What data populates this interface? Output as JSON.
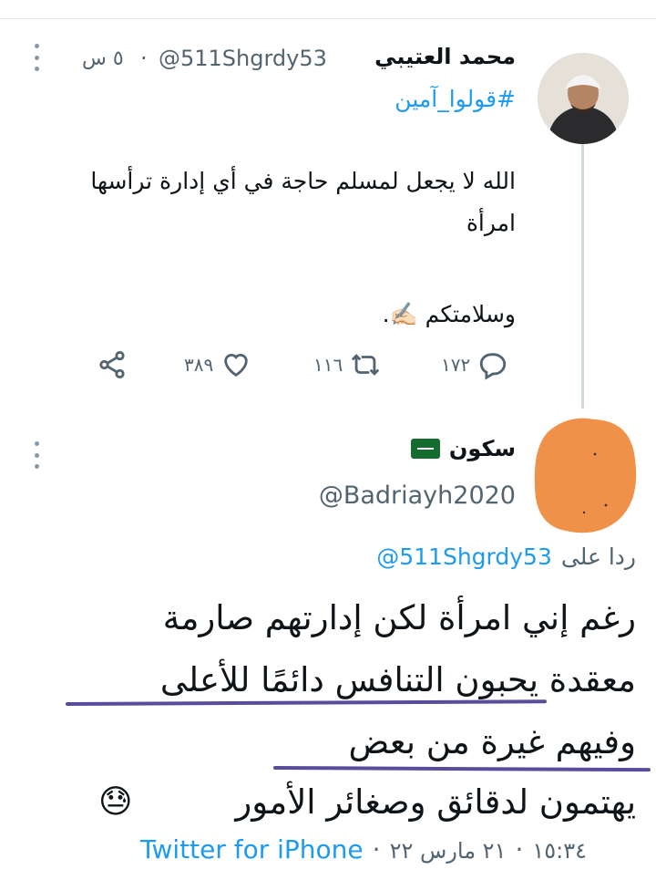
{
  "parent_tweet": {
    "display_name": "محمد العتيبي",
    "handle": "@511Shgrdy53",
    "time": "٥ س",
    "dot": "·",
    "hashtag": "#قولوا_آمين",
    "lines": [
      "الله لا يجعل لمسلم حاجة في أي إدارة ترأسها",
      "امرأة",
      "وسلامتكم ✍🏻."
    ],
    "actions": {
      "reply_count": "١٧٢",
      "retweet_count": "١١٦",
      "like_count": "٣٨٩"
    }
  },
  "reply_tweet": {
    "display_name": "سكون",
    "handle": "@Badriayh2020",
    "replying_to_prefix": "ردا على",
    "replying_to_handle": "@511Shgrdy53",
    "lines": [
      "رغم إني امرأة لكن إدارتهم صارمة",
      "معقدة يحبون التنافس دائمًا للأعلى",
      "وفيهم غيرة من بعض",
      "يهتمون لدقائق وصغائر الأمور"
    ],
    "emoji": "😓",
    "meta_time": "١٥:٣٤",
    "meta_date": "٢١ مارس ٢٢",
    "meta_dot": "·",
    "meta_source": "Twitter for iPhone"
  },
  "colors": {
    "link": "#1d9bf0",
    "text": "#0f1419",
    "muted": "#536471",
    "annotation_underline": "#5b4b9b",
    "privacy_blob": "#f0914a"
  },
  "icons": {
    "more": "more-vertical-icon",
    "reply": "reply-icon",
    "retweet": "retweet-icon",
    "like": "heart-icon",
    "share": "share-icon",
    "flag": "saudi-flag-icon"
  }
}
